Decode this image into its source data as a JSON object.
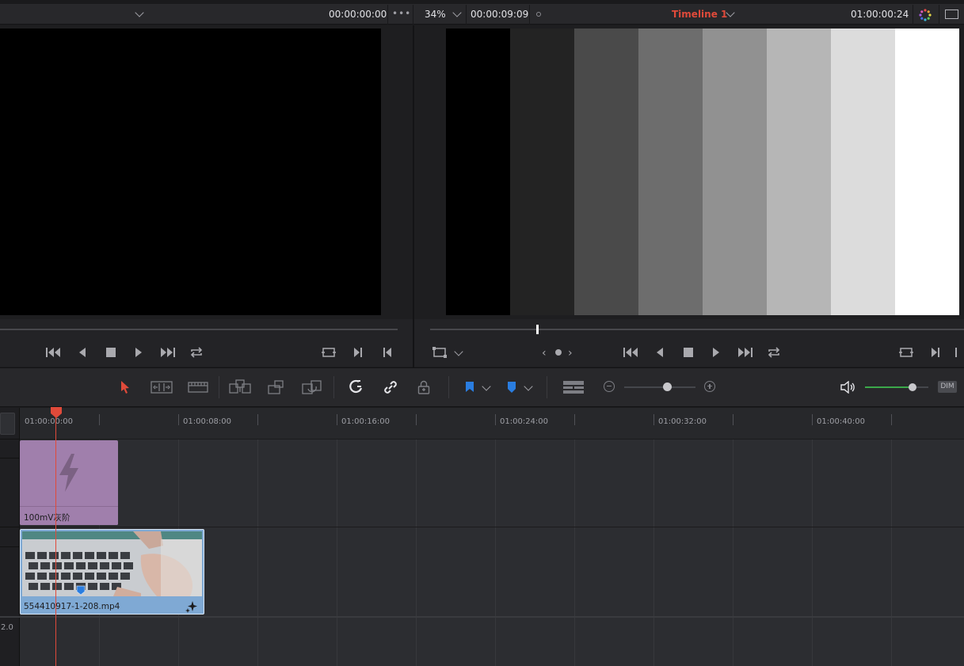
{
  "source_viewer": {
    "timecode": "00:00:00:00",
    "more_label": "•••"
  },
  "timeline_viewer": {
    "zoom": "34%",
    "duration": "00:00:09:09",
    "timeline_name": "Timeline 1",
    "timecode": "01:00:00:24",
    "color_bars": [
      "#000000",
      "#232323",
      "#4a4a4a",
      "#6d6d6d",
      "#919191",
      "#b6b6b6",
      "#dcdcdc",
      "#ffffff"
    ]
  },
  "timeline": {
    "ruler_labels": [
      "01:00:00:00",
      "01:00:08:00",
      "01:00:16:00",
      "01:00:24:00",
      "01:00:32:00",
      "01:00:40:00"
    ],
    "clips": {
      "fusion_clip_name": "100mV灰阶",
      "video_clip_name": "554410917-1-208.mp4"
    },
    "audio_track_label": "2.0"
  },
  "toolbar": {
    "dim_label": "DIM",
    "volume_level": 0.75,
    "zoom_level": 0.6
  },
  "colors": {
    "accent_red": "#e04a3a",
    "flag_blue": "#2a7de0",
    "fusion_clip": "#a07fac",
    "video_clip": "#7fa9d4",
    "volume_green": "#3ba84a"
  }
}
